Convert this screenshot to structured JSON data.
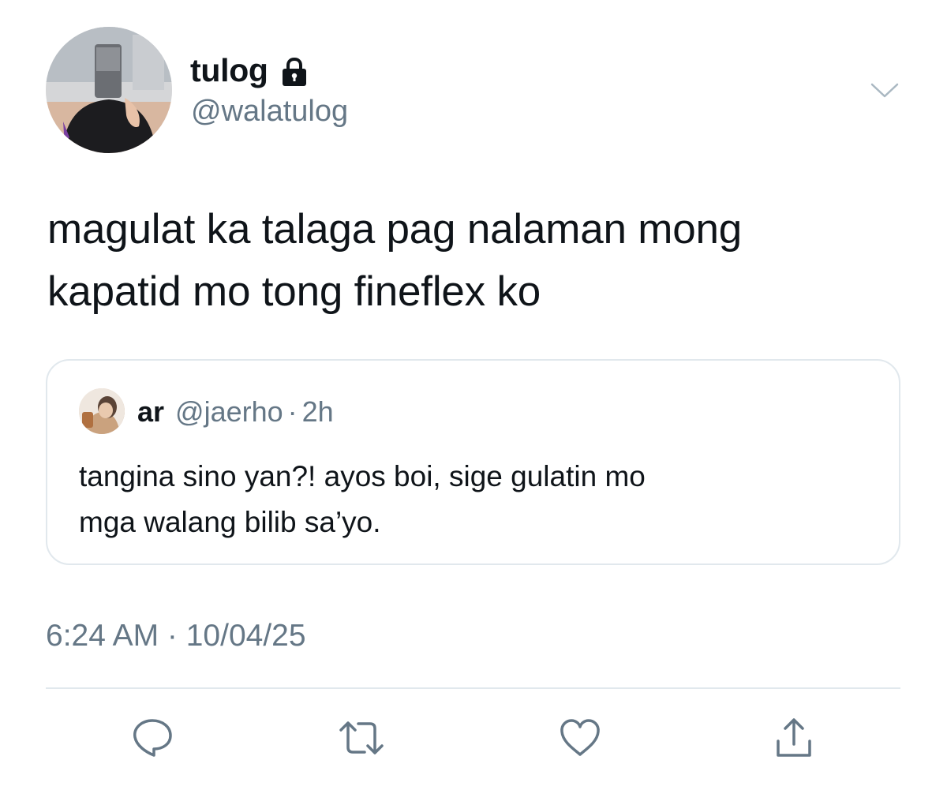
{
  "tweet": {
    "author": {
      "display_name": "tulog",
      "handle": "@walatulog",
      "avatar_icon": "profile-photo",
      "protected_icon": "lock-icon"
    },
    "text_lines": [
      "magulat ka talaga pag nalaman mong",
      "kapatid mo tong fineflex ko"
    ],
    "timestamp": "6:24 AM · 10/04/25"
  },
  "quoted_tweet": {
    "display_name": "ar",
    "handle": "@jaerho",
    "separator": "·",
    "time": "2h",
    "text_lines": [
      "tangina sino yan?! ayos boi, sige gulatin mo",
      "mga walang bilib sa’yo."
    ]
  },
  "actions": {
    "icons": [
      "reply-icon",
      "retweet-icon",
      "like-icon",
      "share-icon"
    ]
  },
  "colors": {
    "text_primary": "#0f1419",
    "text_secondary": "#657786",
    "border": "#e1e8ed",
    "icon": "#657786"
  }
}
